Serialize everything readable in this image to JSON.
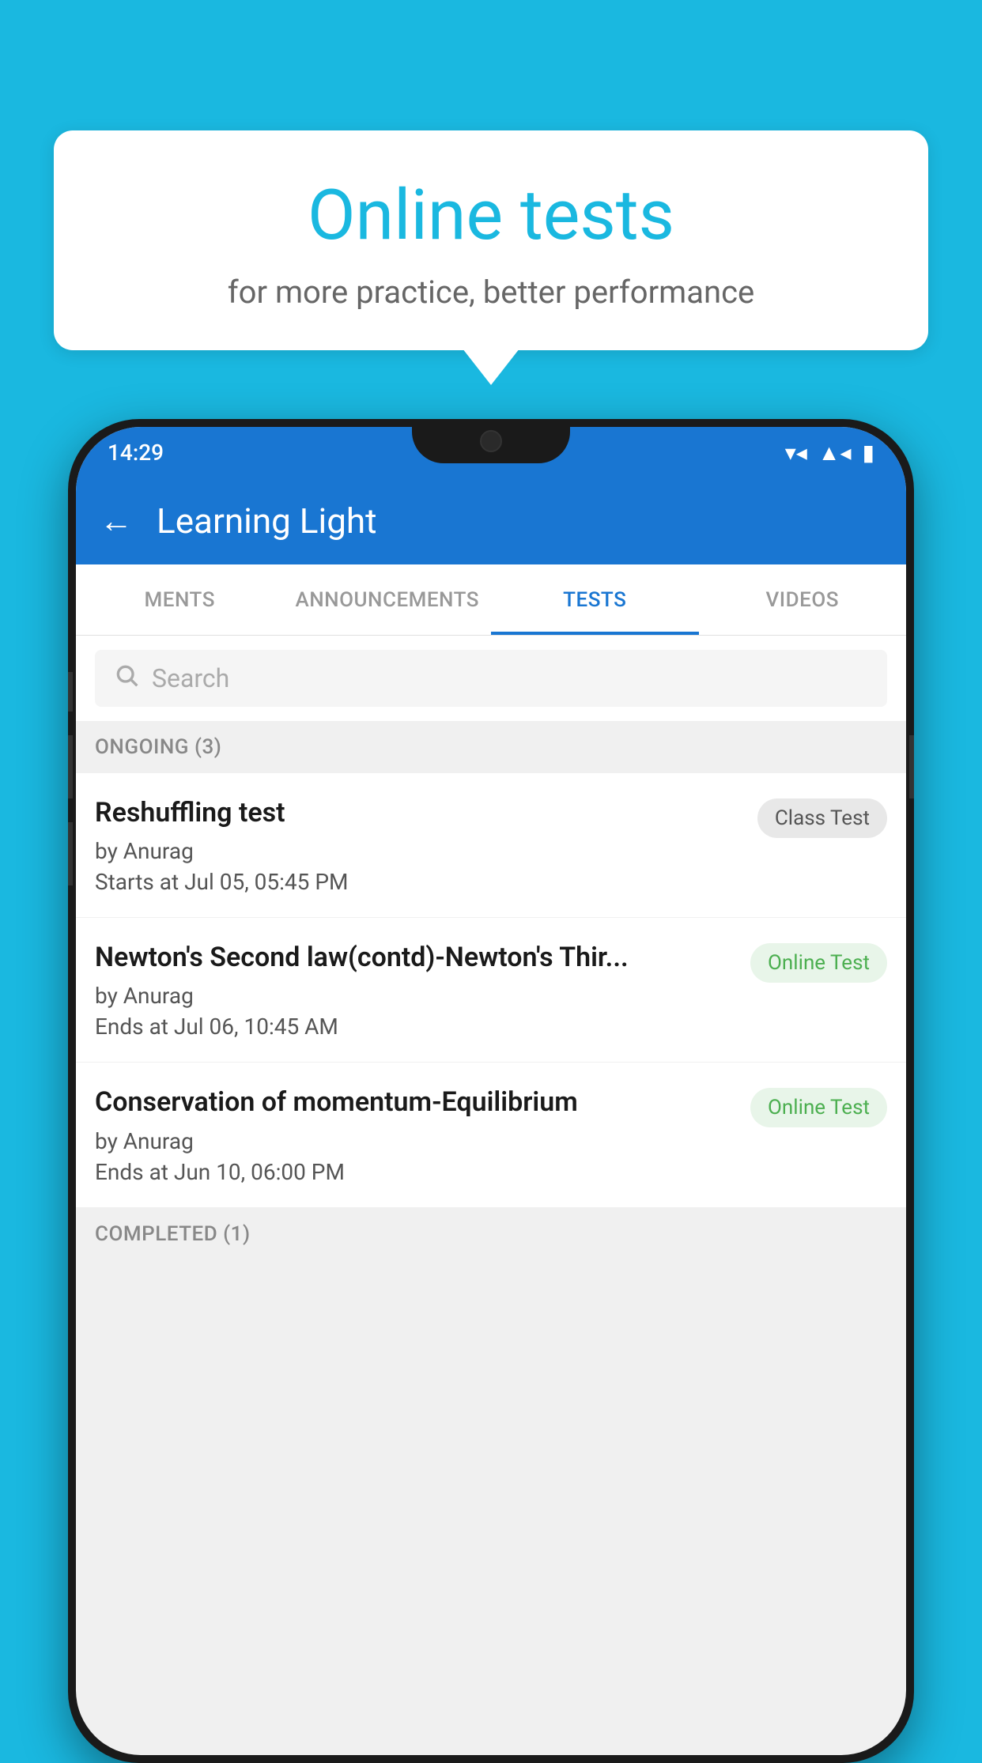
{
  "background": {
    "color": "#1ab8e0"
  },
  "speech_bubble": {
    "title": "Online tests",
    "subtitle": "for more practice, better performance"
  },
  "phone": {
    "status_bar": {
      "time": "14:29",
      "icons": [
        "wifi",
        "signal",
        "battery"
      ]
    },
    "app_bar": {
      "back_label": "←",
      "title": "Learning Light"
    },
    "tabs": [
      {
        "label": "MENTS",
        "active": false
      },
      {
        "label": "ANNOUNCEMENTS",
        "active": false
      },
      {
        "label": "TESTS",
        "active": true
      },
      {
        "label": "VIDEOS",
        "active": false
      }
    ],
    "search": {
      "placeholder": "Search"
    },
    "sections": [
      {
        "header": "ONGOING (3)",
        "items": [
          {
            "name": "Reshuffling test",
            "author": "by Anurag",
            "time": "Starts at  Jul 05, 05:45 PM",
            "badge": "Class Test",
            "badge_type": "class"
          },
          {
            "name": "Newton's Second law(contd)-Newton's Thir...",
            "author": "by Anurag",
            "time": "Ends at  Jul 06, 10:45 AM",
            "badge": "Online Test",
            "badge_type": "online"
          },
          {
            "name": "Conservation of momentum-Equilibrium",
            "author": "by Anurag",
            "time": "Ends at  Jun 10, 06:00 PM",
            "badge": "Online Test",
            "badge_type": "online"
          }
        ]
      },
      {
        "header": "COMPLETED (1)",
        "items": []
      }
    ]
  }
}
